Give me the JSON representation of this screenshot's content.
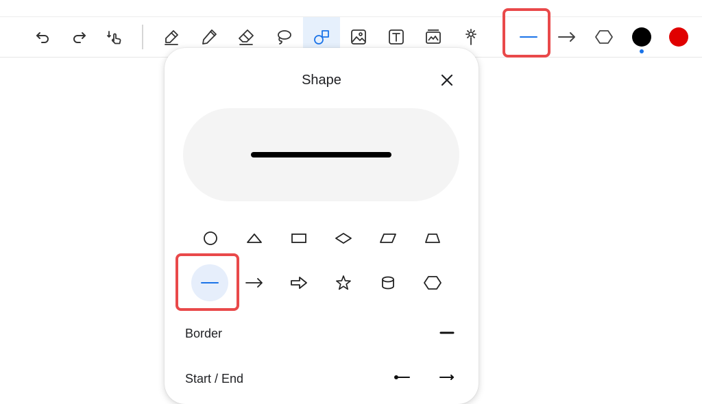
{
  "toolbar": {
    "tools": [
      {
        "name": "undo-icon"
      },
      {
        "name": "redo-icon"
      },
      {
        "name": "touch-select-icon"
      },
      {
        "name": "pen-icon"
      },
      {
        "name": "pencil-icon"
      },
      {
        "name": "eraser-icon"
      },
      {
        "name": "lasso-icon"
      },
      {
        "name": "shapes-icon",
        "active": true
      },
      {
        "name": "image-icon"
      },
      {
        "name": "text-box-icon"
      },
      {
        "name": "sticker-icon"
      },
      {
        "name": "laser-pointer-icon"
      }
    ],
    "shape_options": [
      "line-icon",
      "arrow-icon",
      "hexagon-icon"
    ],
    "colors": [
      "#000000",
      "#e00000"
    ],
    "selected_color": "#000000",
    "accent": "#1a73e8",
    "highlight": "#e9494a"
  },
  "panel": {
    "title": "Shape",
    "shapes_row1": [
      "circle-icon",
      "triangle-icon",
      "rectangle-icon",
      "diamond-icon",
      "parallelogram-icon",
      "trapezoid-icon"
    ],
    "shapes_row2": [
      "line-icon",
      "arrow-icon",
      "block-arrow-icon",
      "star-icon",
      "cylinder-icon",
      "hexagon-icon"
    ],
    "selected_shape": "line-icon",
    "border_label": "Border",
    "start_end_label": "Start / End"
  }
}
